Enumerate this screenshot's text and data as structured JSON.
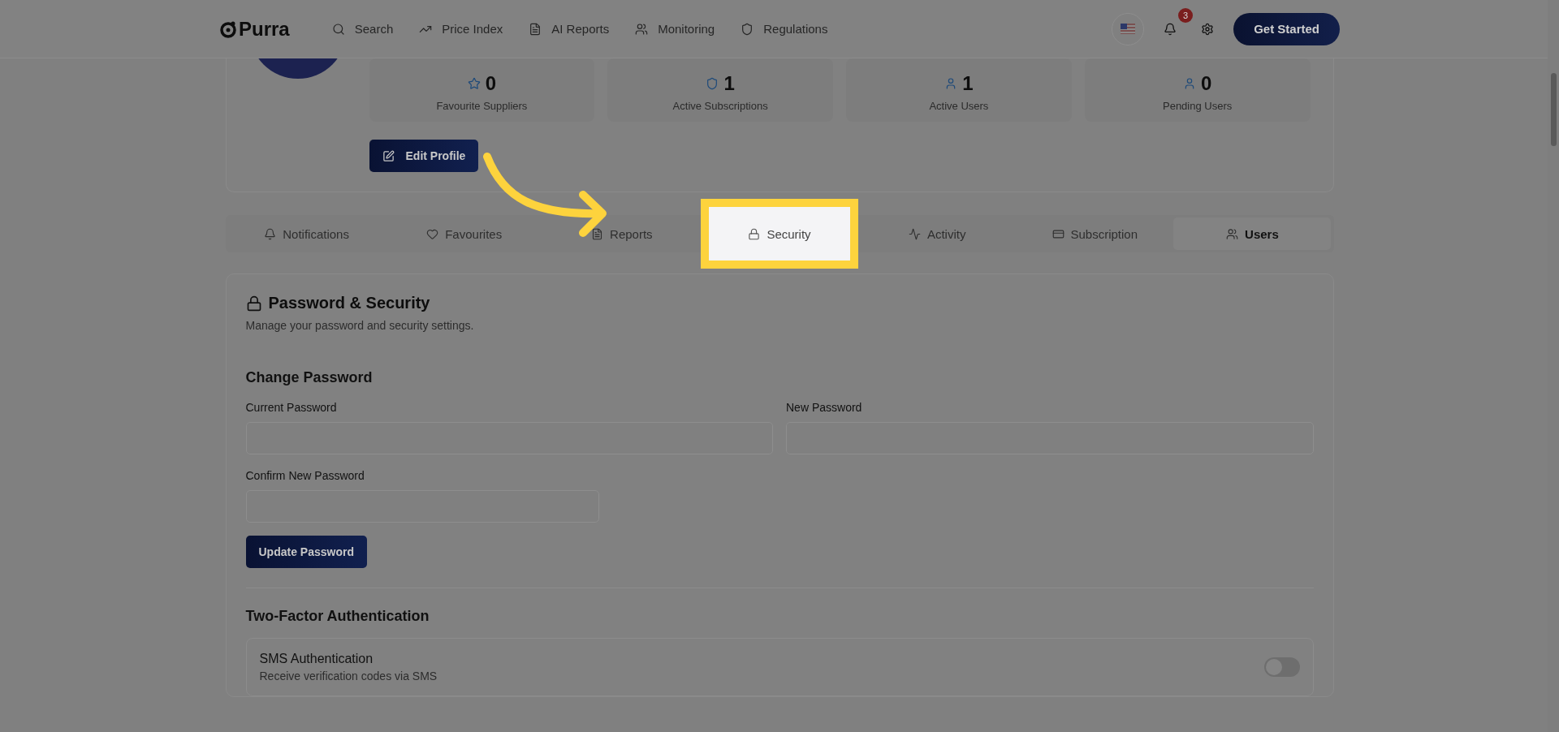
{
  "header": {
    "logo": "Purra",
    "nav": [
      {
        "label": "Search"
      },
      {
        "label": "Price Index"
      },
      {
        "label": "AI Reports"
      },
      {
        "label": "Monitoring"
      },
      {
        "label": "Regulations"
      }
    ],
    "notification_count": "3",
    "cta": "Get Started"
  },
  "profile": {
    "stats": [
      {
        "value": "0",
        "label": "Favourite Suppliers"
      },
      {
        "value": "1",
        "label": "Active Subscriptions"
      },
      {
        "value": "1",
        "label": "Active Users"
      },
      {
        "value": "0",
        "label": "Pending Users"
      }
    ],
    "edit_button": "Edit Profile"
  },
  "tabs": [
    {
      "label": "Notifications",
      "selected": false,
      "highlighted": false
    },
    {
      "label": "Favourites",
      "selected": false,
      "highlighted": false
    },
    {
      "label": "Reports",
      "selected": false,
      "highlighted": false
    },
    {
      "label": "Security",
      "selected": false,
      "highlighted": true
    },
    {
      "label": "Activity",
      "selected": false,
      "highlighted": false
    },
    {
      "label": "Subscription",
      "selected": false,
      "highlighted": false
    },
    {
      "label": "Users",
      "selected": true,
      "highlighted": false
    }
  ],
  "security": {
    "title": "Password & Security",
    "subtitle": "Manage your password and security settings.",
    "change_password": {
      "heading": "Change Password",
      "fields": [
        {
          "label": "Current Password"
        },
        {
          "label": "New Password"
        },
        {
          "label": "Confirm New Password"
        }
      ],
      "button": "Update Password"
    },
    "two_factor": {
      "heading": "Two-Factor Authentication",
      "options": [
        {
          "title": "SMS Authentication",
          "description": "Receive verification codes via SMS",
          "on": false
        }
      ]
    }
  }
}
